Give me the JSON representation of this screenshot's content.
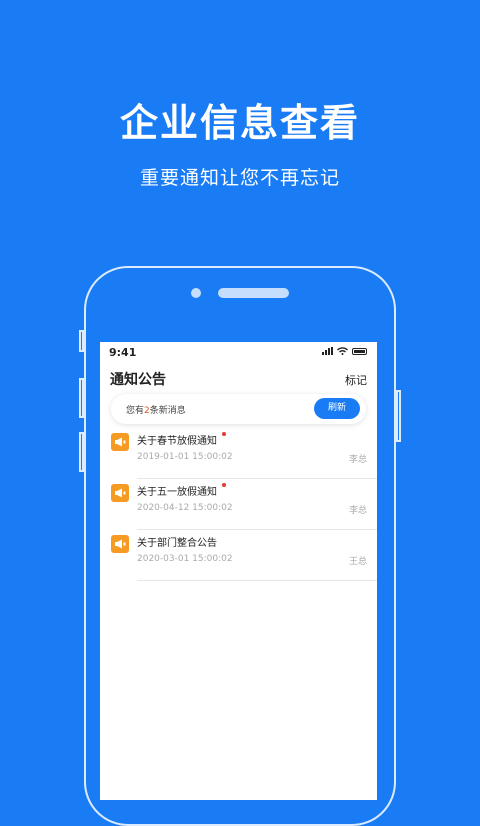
{
  "hero": {
    "title": "企业信息查看",
    "subtitle": "重要通知让您不再忘记"
  },
  "status_bar": {
    "time": "9:41"
  },
  "nav": {
    "title": "通知公告",
    "action": "标记"
  },
  "banner": {
    "prefix": "您有",
    "count": "2",
    "suffix": "条新消息",
    "refresh_label": "刷新"
  },
  "notices": [
    {
      "title": "关于春节放假通知",
      "date": "2019-01-01 15:00:02",
      "author": "李总",
      "unread": true
    },
    {
      "title": "关于五一放假通知",
      "date": "2020-04-12 15:00:02",
      "author": "李总",
      "unread": true
    },
    {
      "title": "关于部门整合公告",
      "date": "2020-03-01 15:00:02",
      "author": "王总",
      "unread": false
    }
  ],
  "colors": {
    "brand_blue": "#1a7cf5",
    "notice_icon": "#f59a23",
    "unread_dot": "#e53935",
    "count_highlight": "#e3591c"
  },
  "icons": {
    "notice": "megaphone-icon",
    "wifi": "wifi-icon",
    "signal": "signal-icon",
    "battery": "battery-icon"
  }
}
